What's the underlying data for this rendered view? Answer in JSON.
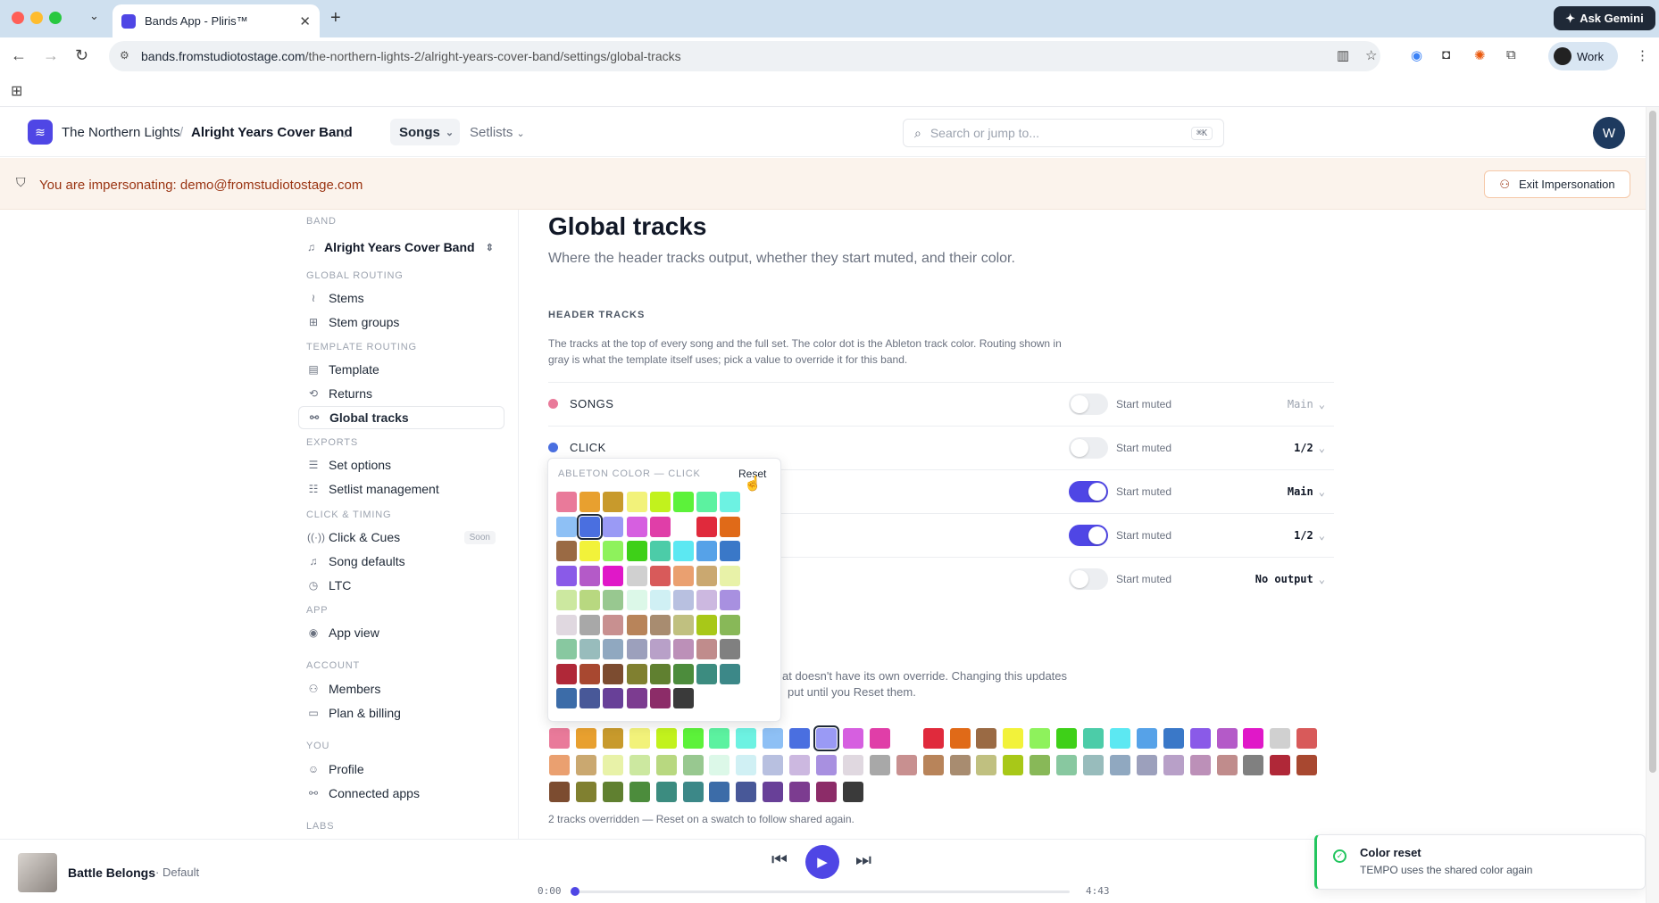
{
  "browser": {
    "tab_title": "Bands App - Pliris™",
    "url_host": "bands.fromstudiotostage.com",
    "url_path": "/the-northern-lights-2/alright-years-cover-band/settings/global-tracks",
    "gemini_label": "Ask Gemini",
    "profile_label": "Work"
  },
  "header": {
    "org": "The Northern Lights",
    "band": "Alright Years Cover Band",
    "nav_songs": "Songs",
    "nav_setlists": "Setlists",
    "search_placeholder": "Search or jump to...",
    "search_kbd": "⌘K",
    "avatar_initial": "W"
  },
  "impersonation": {
    "text": "You are impersonating: demo@fromstudiotostage.com",
    "exit_label": "Exit Impersonation"
  },
  "sidebar": {
    "band_section": "BAND",
    "band_name": "Alright Years Cover Band",
    "sections": {
      "global_routing": "GLOBAL ROUTING",
      "template_routing": "TEMPLATE ROUTING",
      "exports": "EXPORTS",
      "click_timing": "CLICK & TIMING",
      "app": "APP",
      "account": "ACCOUNT",
      "you": "YOU",
      "labs": "LABS"
    },
    "items": {
      "stems": "Stems",
      "stem_groups": "Stem groups",
      "template": "Template",
      "returns": "Returns",
      "global_tracks": "Global tracks",
      "set_options": "Set options",
      "setlist_management": "Setlist management",
      "click_cues": "Click & Cues",
      "click_cues_badge": "Soon",
      "song_defaults": "Song defaults",
      "ltc": "LTC",
      "app_view": "App view",
      "members": "Members",
      "plan_billing": "Plan & billing",
      "profile": "Profile",
      "connected_apps": "Connected apps"
    }
  },
  "main": {
    "title": "Global tracks",
    "subtitle": "Where the header tracks output, whether they start muted, and their color.",
    "header_tracks_label": "HEADER TRACKS",
    "description": "The tracks at the top of every song and the full set. The color dot is the Ableton track color. Routing shown in gray is what the template itself uses; pick a value to override it for this band.",
    "start_muted_label": "Start muted",
    "tracks": [
      {
        "name": "SONGS",
        "color": "#e97a9a",
        "muted": false,
        "route": "Main",
        "route_override": false
      },
      {
        "name": "CLICK",
        "color": "#4a6fe0",
        "muted": false,
        "route": "1/2",
        "route_override": true
      },
      {
        "name": "",
        "color": "",
        "muted": true,
        "route": "Main",
        "route_override": true
      },
      {
        "name": "",
        "color": "",
        "muted": true,
        "route": "1/2",
        "route_override": true
      },
      {
        "name": "",
        "color": "",
        "muted": false,
        "route": "No output",
        "route_override": true
      }
    ],
    "partial_text_1": "at doesn't have its own override. Changing this updates",
    "partial_text_2": "put until you Reset them.",
    "override_note": "2 tracks overridden — Reset on a swatch to follow shared again."
  },
  "popover": {
    "title": "ABLETON COLOR — CLICK",
    "reset_label": "Reset",
    "colors": [
      "#e97a9a",
      "#e8a02f",
      "#c89a2c",
      "#f2f27a",
      "#c2f21d",
      "#5cf23a",
      "#5cf2a0",
      "#6df2e2",
      "#8ec0f5",
      "#4a6fe0",
      "#9a9af5",
      "#d65fe0",
      "#e03ea8",
      "#ffffff",
      "#e02a3c",
      "#e06a18",
      "#9a6a44",
      "#f2f23a",
      "#8ef25c",
      "#3ed018",
      "#4ccca8",
      "#5ce8f2",
      "#56a2e8",
      "#3a78c8",
      "#8a5ae8",
      "#b45ac8",
      "#e018c8",
      "#d0d0d0",
      "#d85a5a",
      "#eaa070",
      "#caa870",
      "#e8f2a8",
      "#cce8a0",
      "#b8d880",
      "#98c890",
      "#dcf8e8",
      "#d0f0f4",
      "#b8c0e0",
      "#ccb8e0",
      "#a890e0",
      "#e0d8e0",
      "#a8a8a8",
      "#c89090",
      "#b8845a",
      "#a88c70",
      "#c0c080",
      "#a8c818",
      "#88b858",
      "#88c8a0",
      "#98bcbc",
      "#90a8c0",
      "#9ca0bc",
      "#b8a0c8",
      "#bc90b8",
      "#c08c8c",
      "#808080",
      "#b02838",
      "#a84830",
      "#7c4c30",
      "#808030",
      "#608030",
      "#4c8c3c",
      "#3c8c80",
      "#3c8888",
      "#3c6ca8",
      "#485898",
      "#684098",
      "#7c3c90",
      "#8c2c68",
      "#3a3a3a"
    ],
    "selected_index": 9
  },
  "shared_palette": {
    "colors": [
      "#e97a9a",
      "#e8a02f",
      "#c89a2c",
      "#f2f27a",
      "#c2f21d",
      "#5cf23a",
      "#5cf2a0",
      "#6df2e2",
      "#8ec0f5",
      "#4a6fe0",
      "#9a9af5",
      "#d65fe0",
      "#e03ea8",
      "#ffffff",
      "#e02a3c",
      "#e06a18",
      "#9a6a44",
      "#f2f23a",
      "#8ef25c",
      "#3ed018",
      "#4ccca8",
      "#5ce8f2",
      "#56a2e8",
      "#3a78c8",
      "#8a5ae8",
      "#b45ac8",
      "#e018c8",
      "#d0d0d0",
      "#d85a5a",
      "#eaa070",
      "#caa870",
      "#e8f2a8",
      "#cce8a0",
      "#b8d880",
      "#98c890",
      "#dcf8e8",
      "#d0f0f4",
      "#b8c0e0",
      "#ccb8e0",
      "#a890e0",
      "#e0d8e0",
      "#a8a8a8",
      "#c89090",
      "#b8845a",
      "#a88c70",
      "#c0c080",
      "#a8c818",
      "#88b858",
      "#88c8a0",
      "#98bcbc",
      "#90a8c0",
      "#9ca0bc",
      "#b8a0c8",
      "#bc90b8",
      "#c08c8c",
      "#808080",
      "#b02838",
      "#a84830",
      "#7c4c30",
      "#808030",
      "#608030",
      "#4c8c3c",
      "#3c8c80",
      "#3c8888",
      "#3c6ca8",
      "#485898",
      "#684098",
      "#7c3c90",
      "#8c2c68",
      "#3a3a3a"
    ],
    "selected_index": 10
  },
  "player": {
    "song_title": "Battle Belongs",
    "song_version": "Default",
    "time_current": "0:00",
    "time_total": "4:43",
    "progress": 0.003
  },
  "toast": {
    "title": "Color reset",
    "message": "TEMPO uses the shared color again"
  },
  "colors": {
    "accent": "#4f46e5",
    "warning_text": "#9a3412",
    "success": "#22c55e"
  }
}
